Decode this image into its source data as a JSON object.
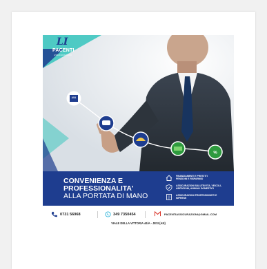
{
  "logo": {
    "monogram": "LI",
    "brand": "PACENTI",
    "sub": "ASSICURAZIONI"
  },
  "insurer_badge": "AXA",
  "headline": {
    "line1": "CONVENIENZA E",
    "line2": "PROFESSIONALITA'",
    "line3": "ALLA PORTATA DI MANO"
  },
  "services": [
    {
      "icon": "house-icon",
      "text": "FINANZIAMENTI E PRESTITI\nPENSIONI E RISPARMIO"
    },
    {
      "icon": "shield-check-icon",
      "text": "ASSICURAZIONI SALUTE/VITA, VEICOLI,\nABITAZIONI, ANIMALI DOMESTICI"
    },
    {
      "icon": "document-icon",
      "text": "ASSICURAZIONI PROFESSIONISTI E\nIMPRESE"
    }
  ],
  "contacts": {
    "phone": "0731 56968",
    "mobile": "349 7350454",
    "email": "PACENTIASSICURAZIONI@GMAIL.COM",
    "address": "VIALE DELLA VITTORIA 44/A - JESI (AN)"
  },
  "colors": {
    "brand_blue": "#1e3d8f",
    "teal": "#3ec6c0",
    "phone_icon": "#1e3d8f",
    "mobile_icon": "#2ab3d9",
    "mail_icon": "#d93025",
    "node_green": "#2e9a3e"
  }
}
